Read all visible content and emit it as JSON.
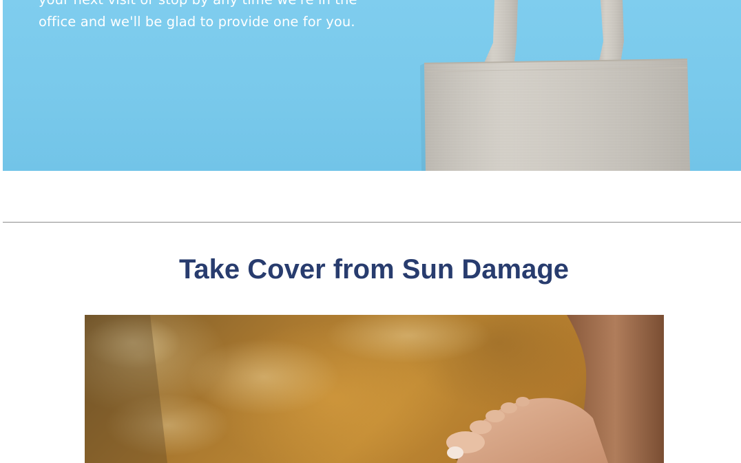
{
  "hero": {
    "text_lines": [
      "your next visit or stop by any time we're in the",
      "office and we'll be glad to provide one for you."
    ],
    "background_color": "#7fcdee",
    "image": "canvas tote bag"
  },
  "section": {
    "title": "Take Cover from Sun Damage",
    "title_color": "#283c6e",
    "image": "feet on sandy beach"
  }
}
